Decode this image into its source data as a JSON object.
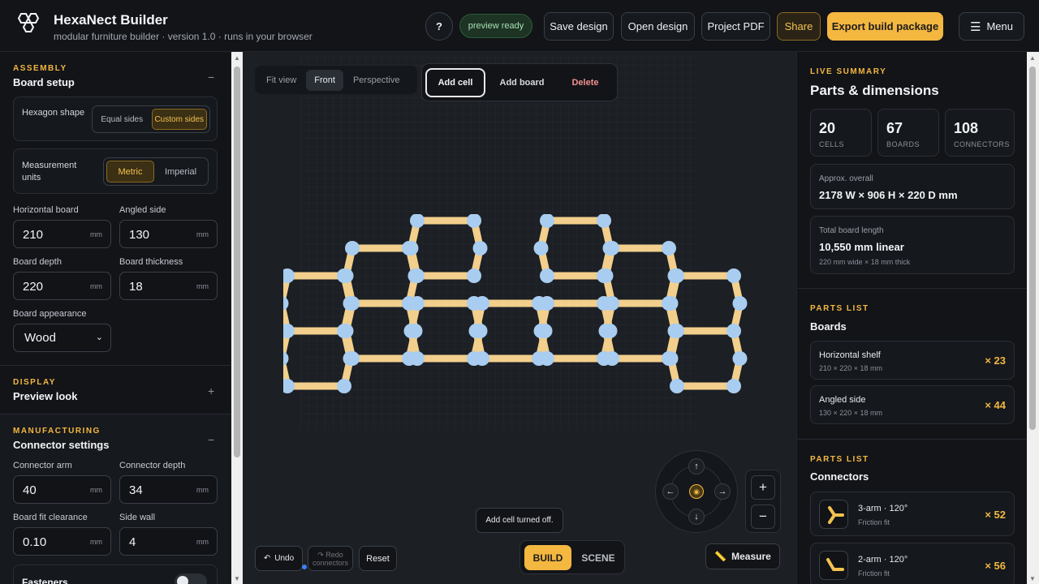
{
  "header": {
    "brand": "HexaNect Builder",
    "tagline": "modular furniture builder · version 1.0 · runs in your browser",
    "help_label": "?",
    "status_badge": "preview ready",
    "buttons": {
      "save": "Save design",
      "open": "Open design",
      "pdf": "Project PDF",
      "share": "Share",
      "export": "Export build package",
      "menu": "Menu"
    }
  },
  "sidebar": {
    "assembly": {
      "kicker": "ASSEMBLY",
      "title": "Board setup",
      "collapse": "−",
      "hexagon_shape": {
        "label": "Hexagon shape",
        "options": [
          "Equal sides",
          "Custom sides"
        ],
        "selected": "Custom sides"
      },
      "measurement_units": {
        "label": "Measurement units",
        "options": [
          "Metric",
          "Imperial"
        ],
        "selected": "Metric"
      },
      "fields": {
        "horizontal_board": {
          "label": "Horizontal board",
          "value": "210",
          "unit": "mm"
        },
        "angled_side": {
          "label": "Angled side",
          "value": "130",
          "unit": "mm"
        },
        "board_depth": {
          "label": "Board depth",
          "value": "220",
          "unit": "mm"
        },
        "board_thickness": {
          "label": "Board thickness",
          "value": "18",
          "unit": "mm"
        }
      },
      "appearance": {
        "label": "Board appearance",
        "value": "Wood"
      }
    },
    "display": {
      "kicker": "DISPLAY",
      "title": "Preview look",
      "expand": "+"
    },
    "manufacturing": {
      "kicker": "MANUFACTURING",
      "title": "Connector settings",
      "collapse": "−",
      "fields": {
        "connector_arm": {
          "label": "Connector arm",
          "value": "40",
          "unit": "mm"
        },
        "connector_depth": {
          "label": "Connector depth",
          "value": "34",
          "unit": "mm"
        },
        "board_fit_clearance": {
          "label": "Board fit clearance",
          "value": "0.10",
          "unit": "mm"
        },
        "side_wall": {
          "label": "Side wall",
          "value": "4",
          "unit": "mm"
        }
      },
      "fasteners_label": "Fasteners"
    }
  },
  "canvas": {
    "views": [
      "Fit view",
      "Front",
      "Perspective"
    ],
    "active_view": "Front",
    "tools": {
      "add_cell": "Add cell",
      "add_board": "Add board",
      "delete": "Delete"
    },
    "active_tool": "Add cell",
    "toast": "Add cell turned off.",
    "undo": "Undo",
    "redo": "Redo",
    "redo_sub": "connectors",
    "reset": "Reset",
    "modes": {
      "build": "BUILD",
      "scene": "SCENE"
    },
    "active_mode": "BUILD",
    "measure": "Measure",
    "pad": {
      "up": "↑",
      "down": "↓",
      "left": "←",
      "right": "→"
    },
    "zoom_in": "+",
    "zoom_out": "−"
  },
  "summary": {
    "kicker": "LIVE SUMMARY",
    "title": "Parts & dimensions",
    "stats": [
      {
        "value": "20",
        "label": "CELLS"
      },
      {
        "value": "67",
        "label": "BOARDS"
      },
      {
        "value": "108",
        "label": "CONNECTORS"
      }
    ],
    "overall": {
      "label": "Approx. overall",
      "value": "2178 W × 906 H × 220 D mm"
    },
    "board_length": {
      "label": "Total board length",
      "value": "10,550 mm linear",
      "sub": "220 mm wide × 18 mm thick"
    }
  },
  "parts_boards": {
    "kicker": "PARTS LIST",
    "title": "Boards",
    "items": [
      {
        "name": "Horizontal shelf",
        "spec": "210 × 220 × 18 mm",
        "qty": "× 23"
      },
      {
        "name": "Angled side",
        "spec": "130 × 220 × 18 mm",
        "qty": "× 44"
      }
    ]
  },
  "parts_connectors": {
    "kicker": "PARTS LIST",
    "title": "Connectors",
    "items": [
      {
        "name": "3-arm · 120°",
        "spec": "Friction fit",
        "qty": "× 52"
      },
      {
        "name": "2-arm · 120°",
        "spec": "Friction fit",
        "qty": "× 56"
      }
    ]
  },
  "colors": {
    "accent": "#f4b740",
    "board": "#f2cf8c",
    "connector": "#a9cdf0",
    "background": "#15181d"
  },
  "icons": [
    "hexagon-logo-icon",
    "menu-icon",
    "undo-icon",
    "redo-icon",
    "ruler-icon",
    "eye-icon",
    "three-arm-connector-icon",
    "two-arm-connector-icon"
  ]
}
